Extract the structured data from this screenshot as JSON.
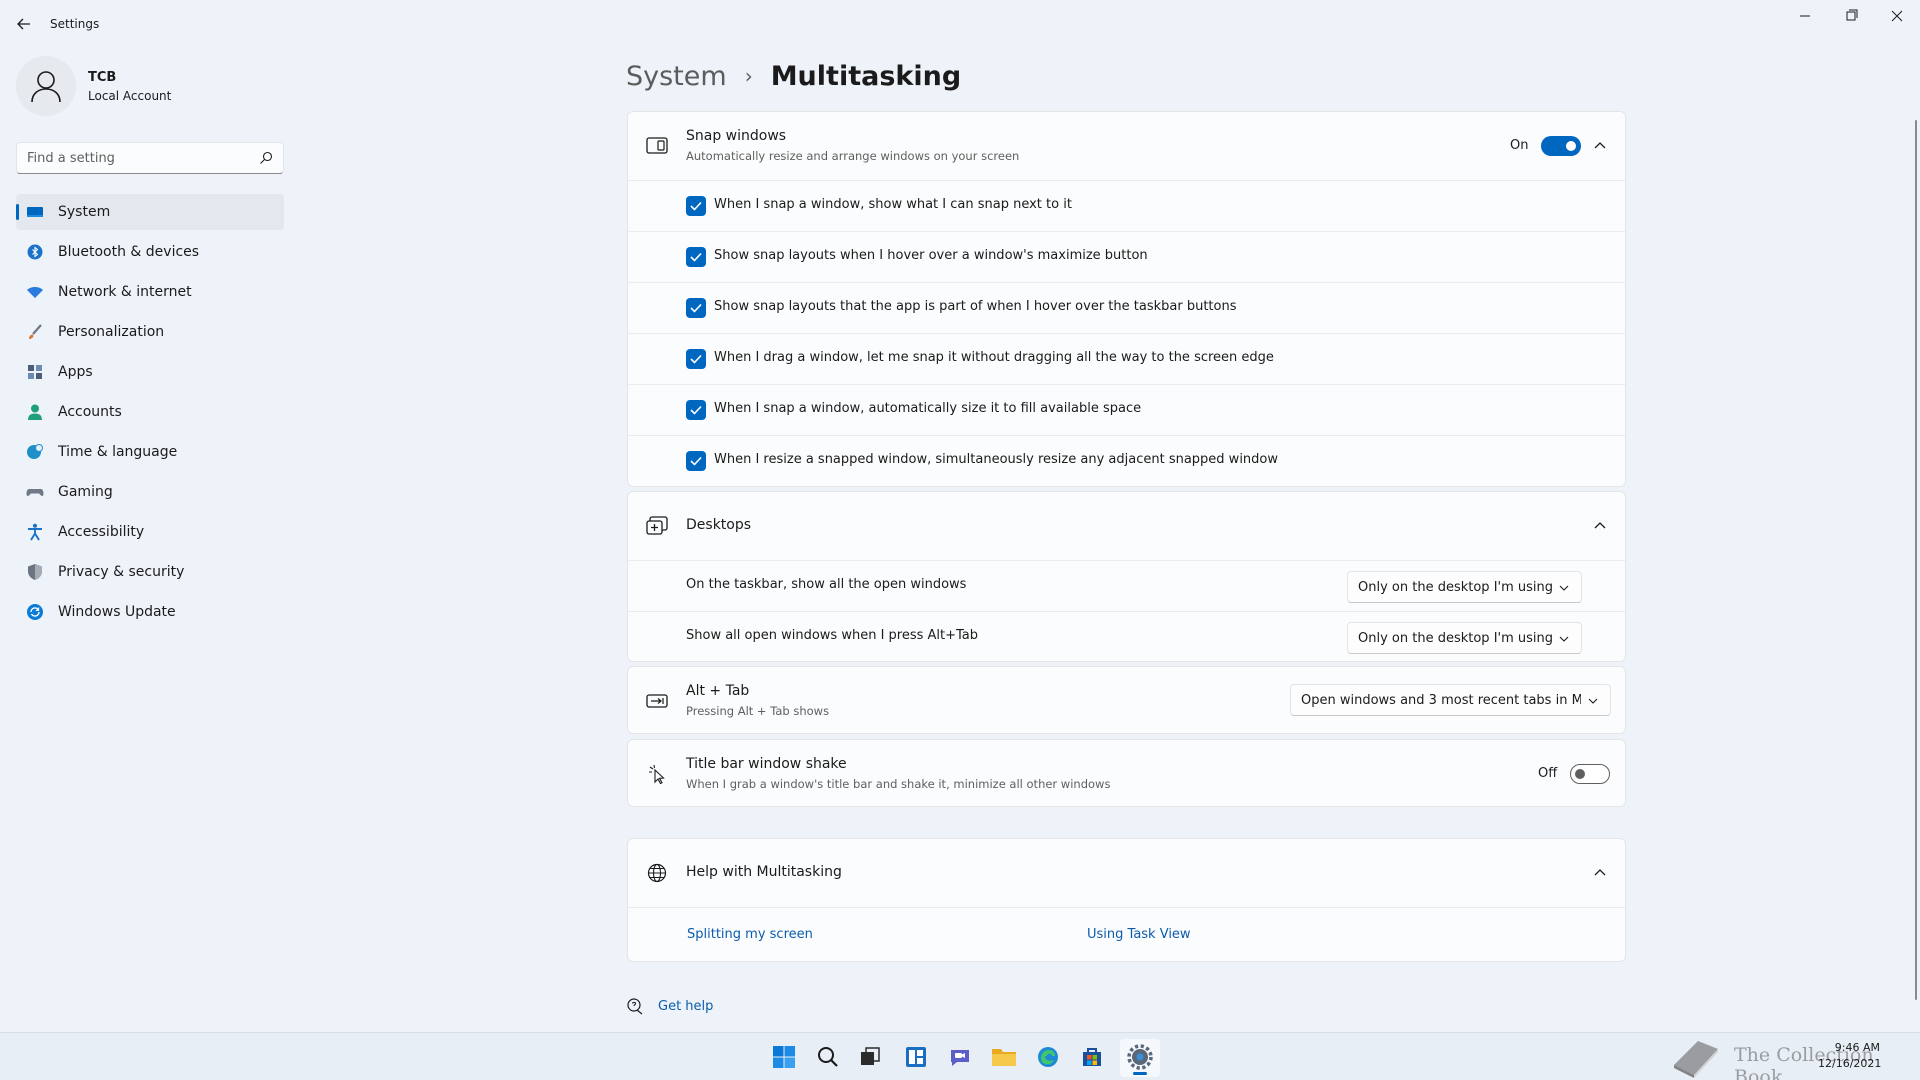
{
  "window": {
    "title": "Settings"
  },
  "profile": {
    "name": "TCB",
    "account_type": "Local Account"
  },
  "search": {
    "placeholder": "Find a setting"
  },
  "nav": [
    {
      "label": "System",
      "icon": "display-icon",
      "color": "#0067c0",
      "active": true
    },
    {
      "label": "Bluetooth & devices",
      "icon": "bluetooth-icon",
      "color": "#1a73c9"
    },
    {
      "label": "Network & internet",
      "icon": "wifi-icon",
      "color": "#2a7be0"
    },
    {
      "label": "Personalization",
      "icon": "brush-icon",
      "color": "#d97a3a"
    },
    {
      "label": "Apps",
      "icon": "apps-icon",
      "color": "#4a5d79"
    },
    {
      "label": "Accounts",
      "icon": "person-icon",
      "color": "#20a07a"
    },
    {
      "label": "Time & language",
      "icon": "globe-clock-icon",
      "color": "#1f8fc9"
    },
    {
      "label": "Gaming",
      "icon": "controller-icon",
      "color": "#707a86"
    },
    {
      "label": "Accessibility",
      "icon": "accessibility-icon",
      "color": "#1a73c9"
    },
    {
      "label": "Privacy & security",
      "icon": "shield-icon",
      "color": "#6b7480"
    },
    {
      "label": "Windows Update",
      "icon": "update-icon",
      "color": "#0a7bd6"
    }
  ],
  "breadcrumb": {
    "root": "System",
    "separator": "›",
    "current": "Multitasking"
  },
  "snap": {
    "title": "Snap windows",
    "subtitle": "Automatically resize and arrange windows on your screen",
    "state_label": "On",
    "enabled": true,
    "options": [
      "When I snap a window, show what I can snap next to it",
      "Show snap layouts when I hover over a window's maximize button",
      "Show snap layouts that the app is part of when I hover over the taskbar buttons",
      "When I drag a window, let me snap it without dragging all the way to the screen edge",
      "When I snap a window, automatically size it to fill available space",
      "When I resize a snapped window, simultaneously resize any adjacent snapped window"
    ]
  },
  "desktops": {
    "title": "Desktops",
    "rows": [
      {
        "label": "On the taskbar, show all the open windows",
        "value": "Only on the desktop I'm using"
      },
      {
        "label": "Show all open windows when I press Alt+Tab",
        "value": "Only on the desktop I'm using"
      }
    ]
  },
  "alttab": {
    "title": "Alt + Tab",
    "subtitle": "Pressing Alt + Tab shows",
    "value": "Open windows and 3 most recent tabs in M"
  },
  "shake": {
    "title": "Title bar window shake",
    "subtitle": "When I grab a window's title bar and shake it, minimize all other windows",
    "state_label": "Off",
    "enabled": false
  },
  "help": {
    "title": "Help with Multitasking",
    "links": [
      "Splitting my screen",
      "Using Task View"
    ]
  },
  "get_help": "Get help",
  "taskbar": {
    "time": "9:46 AM",
    "date": "12/16/2021",
    "watermark": "The Collection Book"
  },
  "colors": {
    "accent": "#0067c0",
    "link": "#0b5cad",
    "background": "#eef3f9",
    "card": "#fbfcfd"
  }
}
